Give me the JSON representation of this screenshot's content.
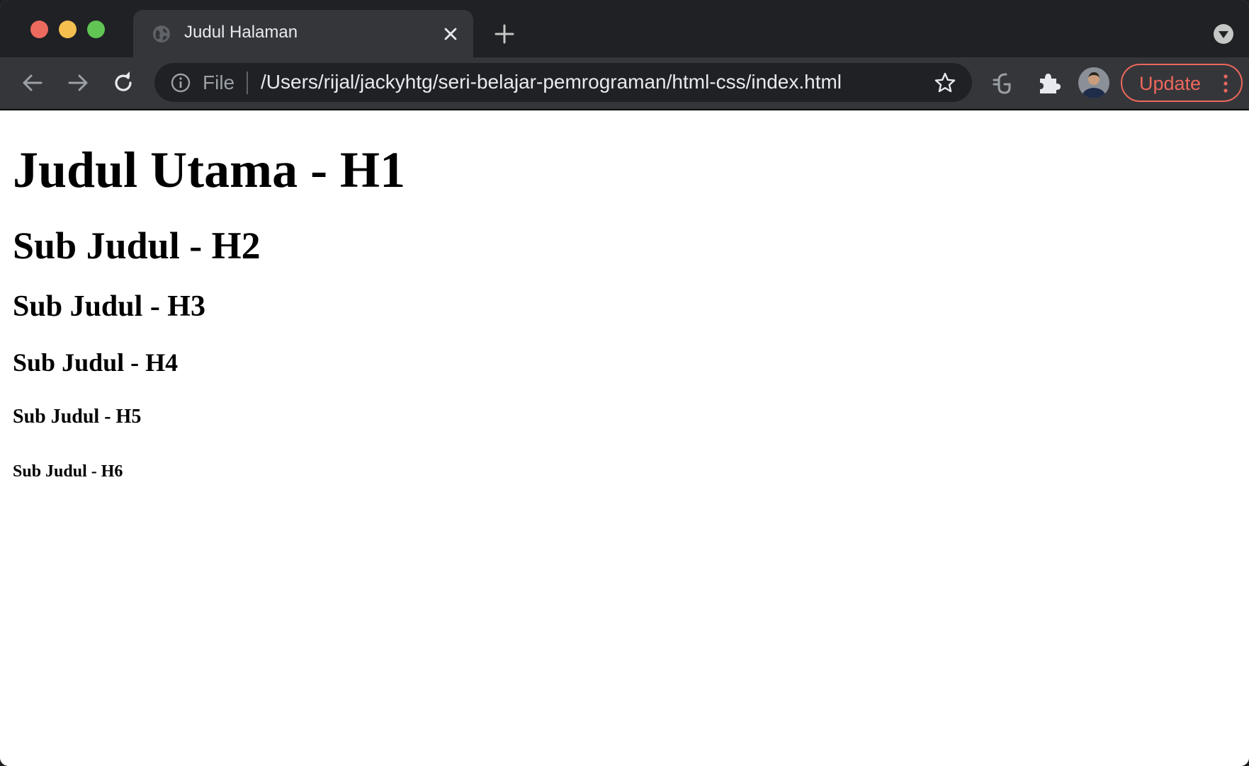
{
  "tab": {
    "title": "Judul Halaman"
  },
  "omnibox": {
    "scheme_label": "File",
    "url": "/Users/rijal/jackyhtg/seri-belajar-pemrograman/html-css/index.html"
  },
  "toolbar": {
    "update_label": "Update"
  },
  "icons": {
    "back": "arrow-left-icon",
    "forward": "arrow-right-icon",
    "reload": "reload-icon",
    "info": "info-icon",
    "bookmark": "star-icon",
    "extension_g": "g-extension-icon",
    "extensions": "puzzle-icon",
    "menu": "kebab-menu-icon",
    "new_tab": "plus-icon",
    "tab_close": "close-icon",
    "tab_search": "chevron-down-icon",
    "favicon": "globe-icon"
  },
  "colors": {
    "tabstrip_bg": "#202124",
    "toolbar_bg": "#35363a",
    "omnibox_bg": "#202124",
    "update_accent": "#ee675c",
    "close_red": "#ed6a5e",
    "minimize_yellow": "#f4bf4f",
    "zoom_green": "#61c554"
  },
  "page": {
    "h1": "Judul Utama - H1",
    "h2": "Sub Judul - H2",
    "h3": "Sub Judul - H3",
    "h4": "Sub Judul - H4",
    "h5": "Sub Judul - H5",
    "h6": "Sub Judul - H6"
  }
}
